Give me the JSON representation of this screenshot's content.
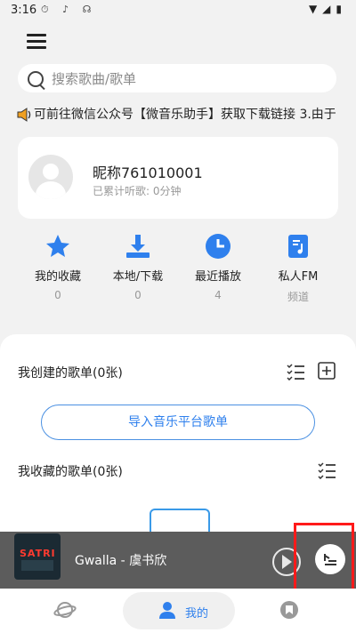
{
  "status_bar": {
    "time": "3:16"
  },
  "search": {
    "placeholder": "搜索歌曲/歌单"
  },
  "notice": {
    "text": "可前往微信公众号【微音乐助手】获取下载链接  3.由于"
  },
  "profile": {
    "nickname": "昵称761010001",
    "listen_info": "已累计听歌: 0分钟"
  },
  "quick_actions": [
    {
      "label": "我的收藏",
      "count": "0",
      "icon": "star-icon"
    },
    {
      "label": "本地/下载",
      "count": "0",
      "icon": "download-icon"
    },
    {
      "label": "最近播放",
      "count": "4",
      "icon": "clock-icon"
    },
    {
      "label": "私人FM",
      "count": "频道",
      "icon": "music-note-icon"
    }
  ],
  "sections": {
    "created_title": "我创建的歌单(0张)",
    "import_label": "导入音乐平台歌单",
    "collected_title": "我收藏的歌单(0张)"
  },
  "player": {
    "track": "Gwalla  -  虞书欣",
    "cover_text": "SATRI"
  },
  "bottom_nav": {
    "active_label": "我的"
  },
  "colors": {
    "accent": "#2f80ed",
    "highlight": "#ff1a1a"
  }
}
